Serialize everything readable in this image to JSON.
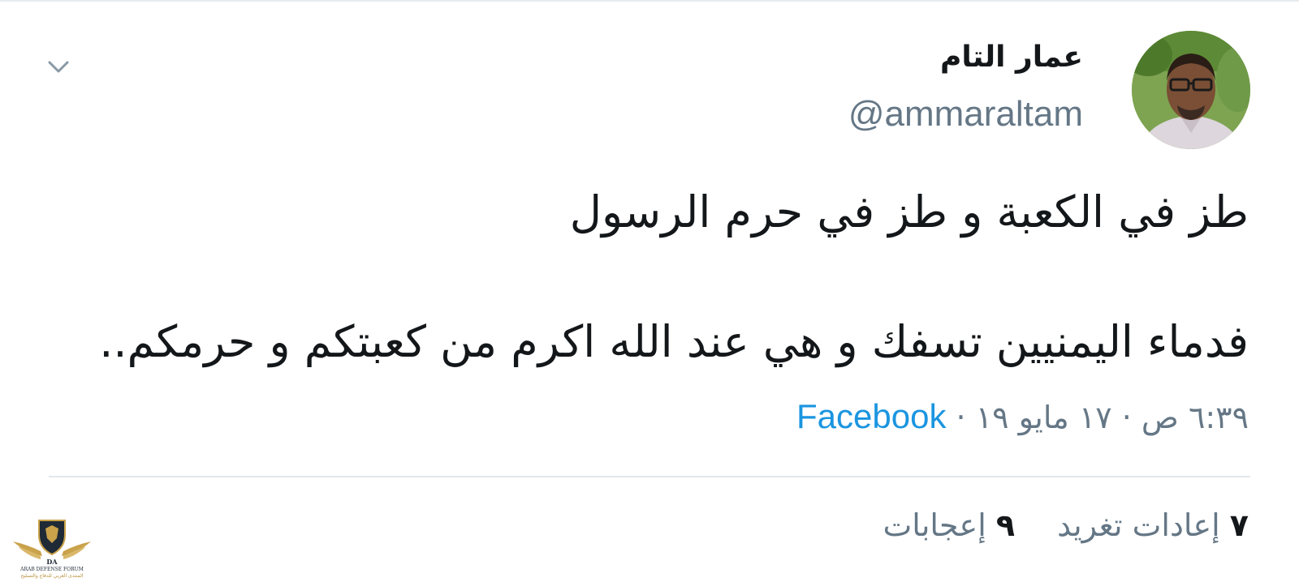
{
  "tweet": {
    "display_name": "عمار التام",
    "handle": "@ammaraltam",
    "text_line1": "طز في الكعبة و طز في حرم الرسول",
    "text_line2": "فدماء اليمنيين تسفك و هي عند الله اكرم من كعبتكم و حرمكم..",
    "timestamp": "٦:٣٩ ص · ١٧ مايو ١٩",
    "separator": " · ",
    "source": "Facebook"
  },
  "stats": {
    "retweets_count": "٧",
    "retweets_label": "إعادات تغريد",
    "likes_count": "٩",
    "likes_label": "إعجابات"
  },
  "watermark": {
    "brand": "DA",
    "text_en": "ARAB DEFENSE FORUM",
    "text_ar": "المنتدى العربي للدفاع والتسليح"
  },
  "colors": {
    "text": "#14171a",
    "secondary": "#657786",
    "link": "#1b95e0",
    "divider": "#e1e8ed"
  },
  "icons": {
    "caret": "chevron-down-icon"
  }
}
